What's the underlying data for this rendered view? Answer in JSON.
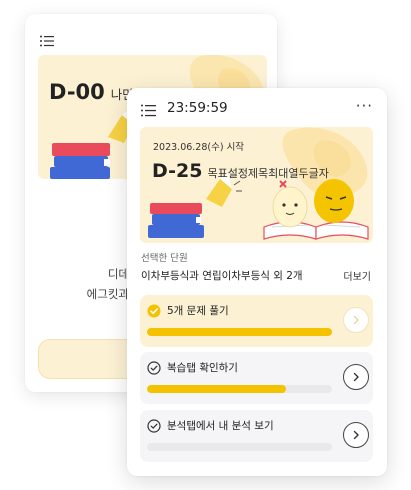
{
  "back_card": {
    "dday_number": "D-00",
    "dday_title": "나만의 디데이 만들기",
    "heading": "나만의",
    "sub_line1": "디데",
    "sub_line2": "에그킷과"
  },
  "front_card": {
    "header": {
      "time": "23:59:59",
      "more": "···"
    },
    "banner": {
      "start_date": "2023.06.28(수) 시작",
      "dday_number": "D-25",
      "dday_title": "목표설정제목최대열두글자"
    },
    "selected_unit": {
      "label": "선택한 단원",
      "value": "이차부등식과 연립이차부등식 외 2개",
      "more_link": "더보기"
    },
    "tasks": [
      {
        "label": "5개 문제 풀기",
        "progress": 1.0,
        "done": true
      },
      {
        "label": "복습탭 확인하기",
        "progress": 0.75,
        "done": false
      },
      {
        "label": "분석탭에서 내 분석 보기",
        "progress": 0.0,
        "done": false
      }
    ]
  },
  "colors": {
    "accent_yellow": "#f5c200",
    "banner_bg": "#fdf1d4"
  }
}
